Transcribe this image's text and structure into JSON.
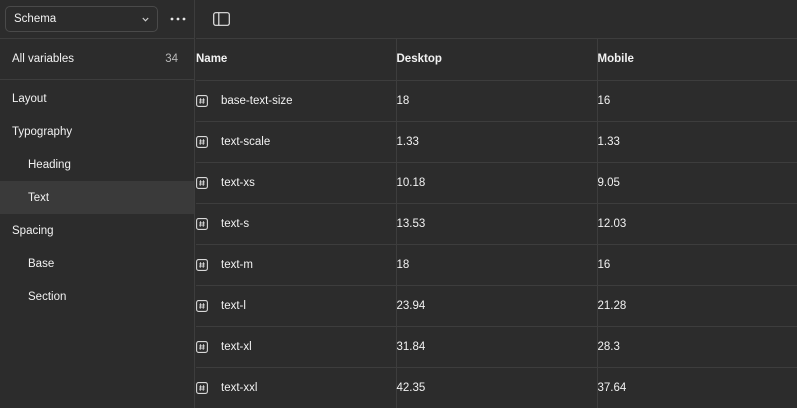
{
  "sidebar": {
    "collection_select": {
      "label": "Schema"
    },
    "all_variables": {
      "label": "All variables",
      "count": "34"
    },
    "groups": [
      {
        "label": "Layout",
        "level": 0,
        "active": false
      },
      {
        "label": "Typography",
        "level": 0,
        "active": false
      },
      {
        "label": "Heading",
        "level": 1,
        "active": false
      },
      {
        "label": "Text",
        "level": 1,
        "active": true
      },
      {
        "label": "Spacing",
        "level": 0,
        "active": false
      },
      {
        "label": "Base",
        "level": 1,
        "active": false
      },
      {
        "label": "Section",
        "level": 1,
        "active": false
      }
    ]
  },
  "table": {
    "headers": {
      "name": "Name",
      "desktop": "Desktop",
      "mobile": "Mobile"
    },
    "rows": [
      {
        "name": "base-text-size",
        "desktop": "18",
        "mobile": "16"
      },
      {
        "name": "text-scale",
        "desktop": "1.33",
        "mobile": "1.33"
      },
      {
        "name": "text-xs",
        "desktop": "10.18",
        "mobile": "9.05"
      },
      {
        "name": "text-s",
        "desktop": "13.53",
        "mobile": "12.03"
      },
      {
        "name": "text-m",
        "desktop": "18",
        "mobile": "16"
      },
      {
        "name": "text-l",
        "desktop": "23.94",
        "mobile": "21.28"
      },
      {
        "name": "text-xl",
        "desktop": "31.84",
        "mobile": "28.3"
      },
      {
        "name": "text-xxl",
        "desktop": "42.35",
        "mobile": "37.64"
      }
    ]
  },
  "icons": {
    "collection_chevron": "chevron-down-icon",
    "more": "more-icon",
    "panel_toggle": "sidebar-panel-icon",
    "variable_type": "number-variable-icon"
  },
  "colors": {
    "background": "#2c2c2c",
    "divider": "#3d3d3d",
    "active_row": "#3a3a3a",
    "text": "#f2f2f2",
    "muted_text": "#b8b8b8"
  }
}
